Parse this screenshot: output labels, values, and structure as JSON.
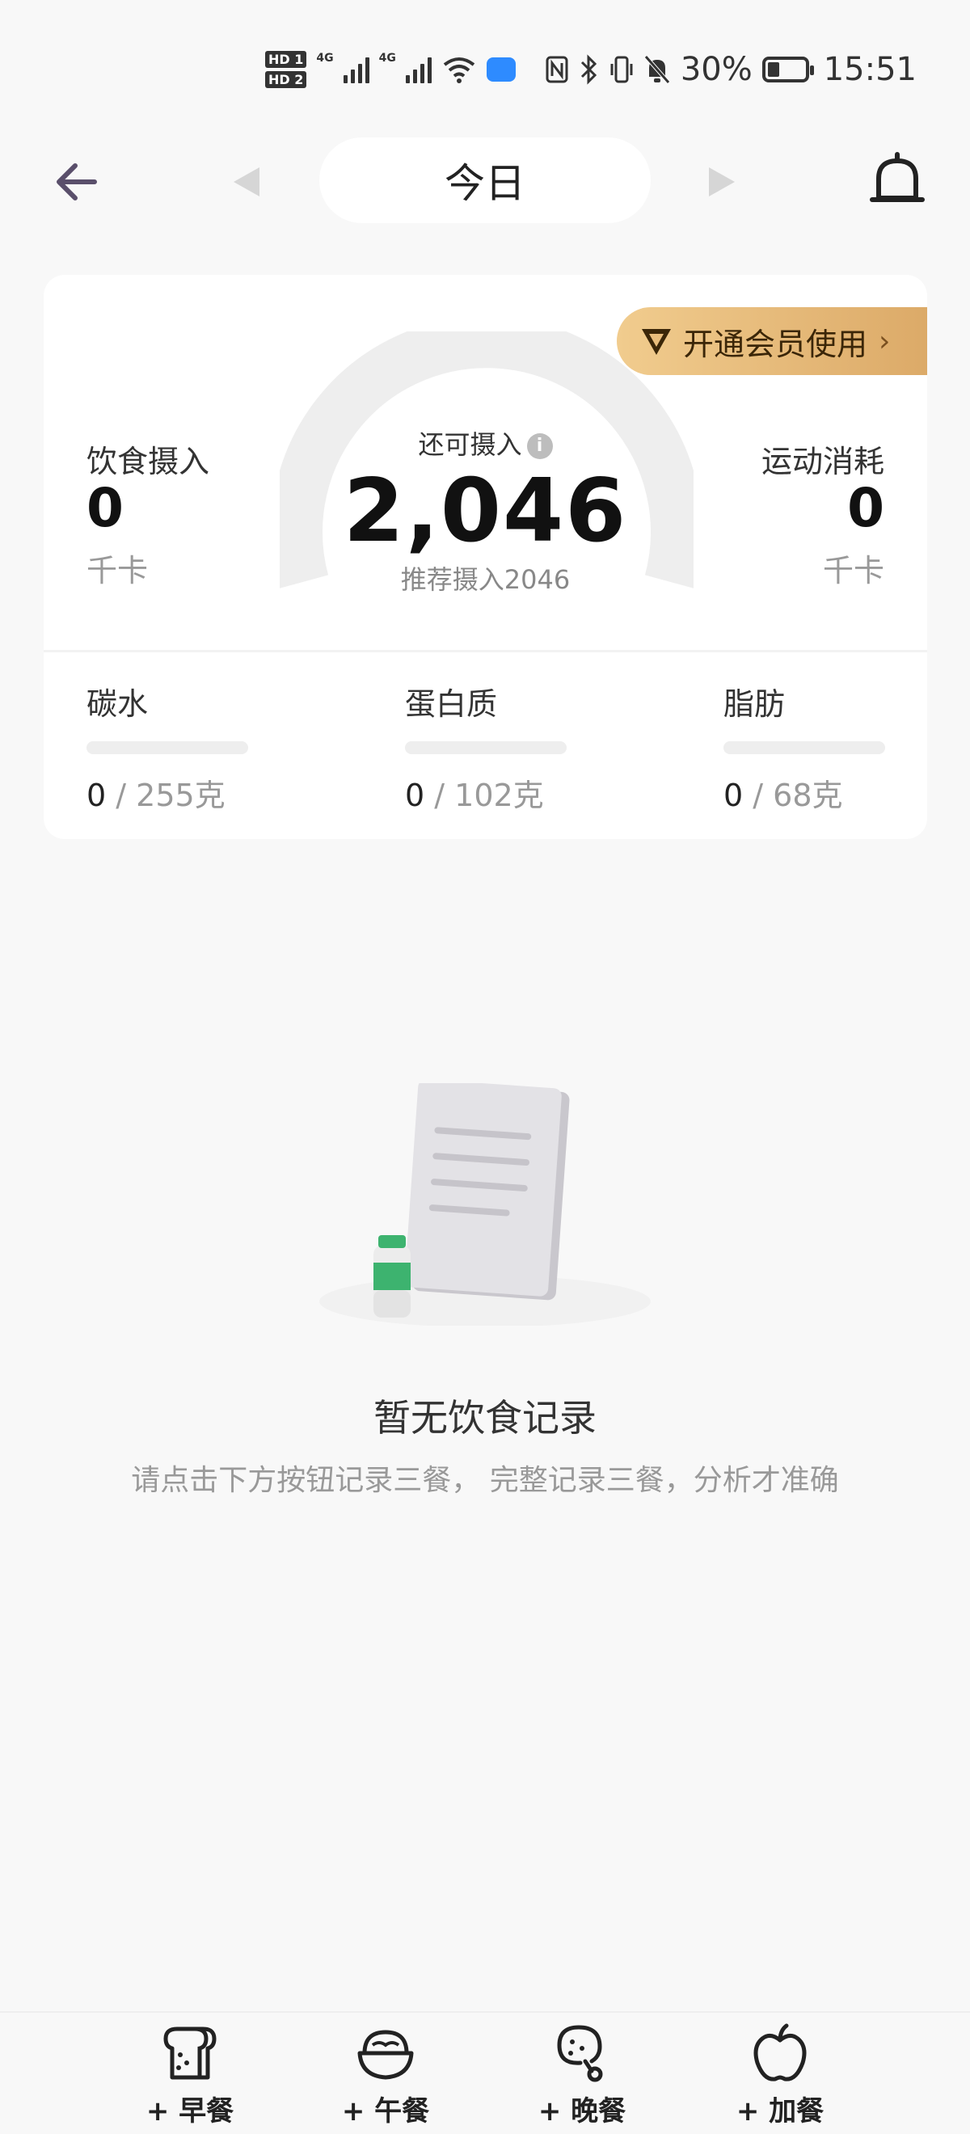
{
  "status_bar": {
    "hd1": "HD 1",
    "hd2": "HD 2",
    "net1": "4G",
    "net2": "4G",
    "battery_percent": "30%",
    "time": "15:51"
  },
  "header": {
    "date_label": "今日"
  },
  "vip": {
    "label": "开通会员使用"
  },
  "summary": {
    "remaining_label": "还可摄入",
    "remaining_value": "2,046",
    "recommend_text": "推荐摄入2046",
    "intake_label": "饮食摄入",
    "intake_value": "0",
    "intake_unit": "千卡",
    "burn_label": "运动消耗",
    "burn_value": "0",
    "burn_unit": "千卡",
    "gauge_progress": 0
  },
  "macros": [
    {
      "name": "碳水",
      "current": "0",
      "target": " / 255克",
      "progress": 0
    },
    {
      "name": "蛋白质",
      "current": "0",
      "target": " / 102克",
      "progress": 0
    },
    {
      "name": "脂肪",
      "current": "0",
      "target": " / 68克",
      "progress": 0
    }
  ],
  "empty_state": {
    "title": "暂无饮食记录",
    "hint": "请点击下方按钮记录三餐，  完整记录三餐，分析才准确"
  },
  "bottom_bar": {
    "items": [
      {
        "label": "+ 早餐",
        "icon": "toast-icon"
      },
      {
        "label": "+ 午餐",
        "icon": "rice-bowl-icon"
      },
      {
        "label": "+ 晚餐",
        "icon": "chicken-leg-icon"
      },
      {
        "label": "+ 加餐",
        "icon": "apple-icon"
      }
    ]
  },
  "colors": {
    "accent_green": "#3dbb7a",
    "vip_gold": "#dcaa68",
    "background": "#f8f8f8"
  }
}
